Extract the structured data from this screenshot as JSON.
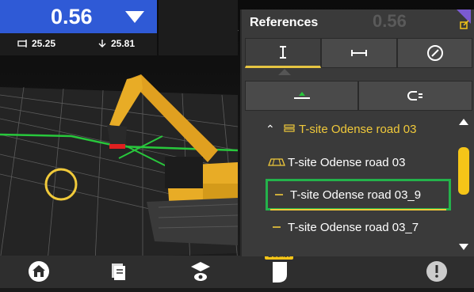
{
  "readout": {
    "value": "0.56",
    "left_value": "25.25",
    "right_value": "25.81",
    "bar_color": "#2f5ad6"
  },
  "references": {
    "title": "References",
    "ghost_value": "0.56",
    "tabs": [
      {
        "icon": "vertical-measure-icon",
        "active": true
      },
      {
        "icon": "horizontal-measure-icon",
        "active": false
      },
      {
        "icon": "compass-icon",
        "active": false
      }
    ],
    "subtabs": [
      {
        "icon": "surface-icon"
      },
      {
        "icon": "magnet-icon"
      }
    ],
    "list": {
      "header": "T-site Odense road 03",
      "items": [
        {
          "label": "T-site Odense road 03",
          "icon": "road-surface-icon",
          "selected": false
        },
        {
          "label": "T-site Odense road 03_9",
          "icon": "line-icon",
          "selected": true
        },
        {
          "label": "T-site Odense road 03_7",
          "icon": "line-icon",
          "selected": false
        }
      ]
    },
    "accent_color": "#f5c518",
    "selection_color": "#24b24b"
  },
  "bottom": {
    "bucket_label": "Bucket"
  }
}
